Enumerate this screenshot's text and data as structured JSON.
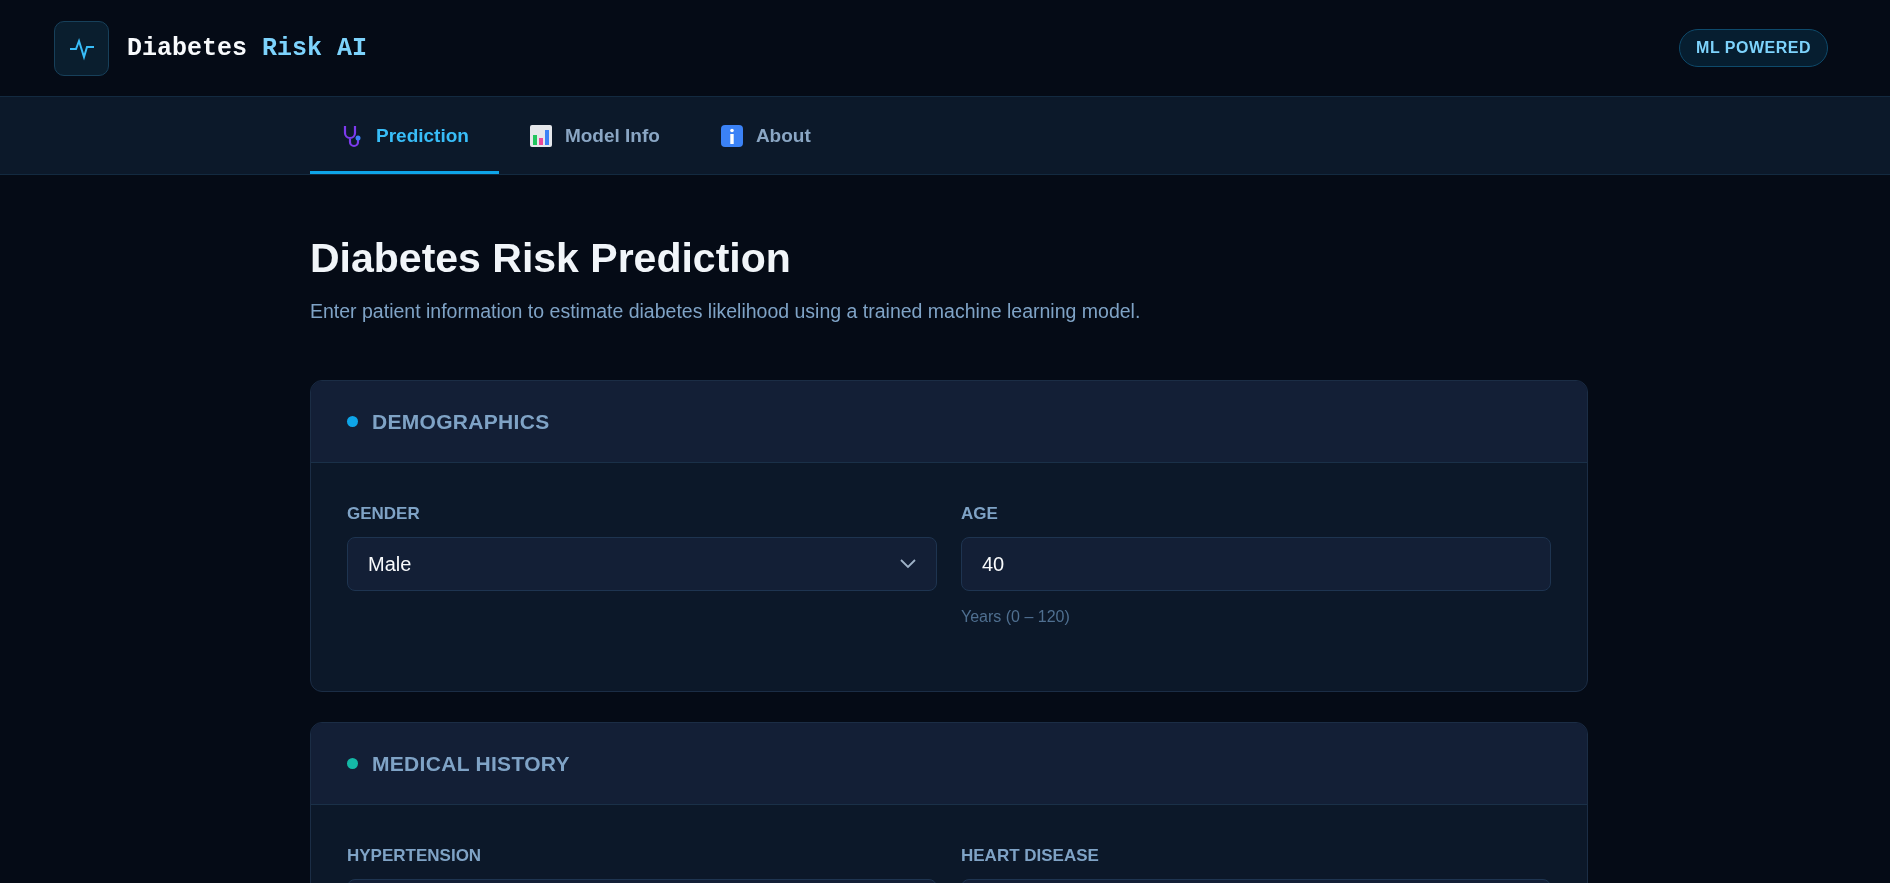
{
  "brand": {
    "name": "Diabetes",
    "accent": "Risk AI"
  },
  "badge": "ML POWERED",
  "tabs": [
    {
      "label": "Prediction",
      "selected": true
    },
    {
      "label": "Model Info",
      "selected": false
    },
    {
      "label": "About",
      "selected": false
    }
  ],
  "heading": "Diabetes Risk Prediction",
  "subtitle": "Enter patient information to estimate diabetes likelihood using a trained machine learning model.",
  "sections": [
    {
      "title": "DEMOGRAPHICS",
      "color": "#0ea5e9",
      "fields": [
        {
          "label": "GENDER",
          "kind": "select",
          "value": "Male"
        },
        {
          "label": "AGE",
          "kind": "number",
          "value": "40",
          "hint": "Years (0 – 120)"
        }
      ]
    },
    {
      "title": "MEDICAL HISTORY",
      "color": "#14b8a6",
      "fields": [
        {
          "label": "HYPERTENSION"
        },
        {
          "label": "HEART DISEASE"
        }
      ]
    }
  ]
}
